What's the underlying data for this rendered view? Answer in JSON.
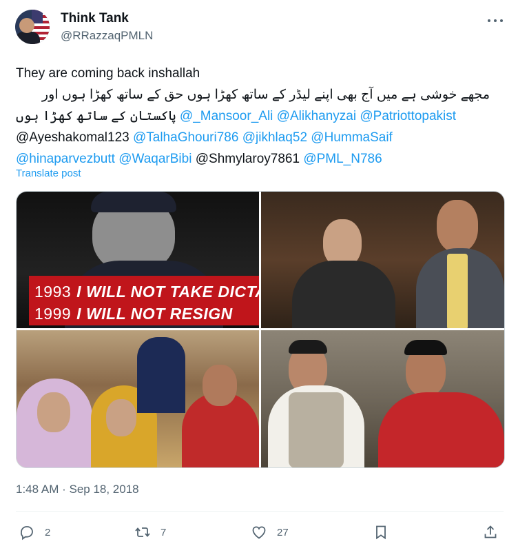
{
  "author": {
    "display_name": "Think Tank",
    "handle": "@RRazzaqPMLN"
  },
  "post": {
    "line1": "They are coming back inshallah",
    "urdu_line1": "مجھے خوشی ہے میں آج بھی اپنے لیڈر کے ساتھ کھڑا ہوں حق کے ساتھ کھڑا ہوں اور",
    "urdu_line2": "پاکستان کے ساتھ کھڑا ہوں",
    "mentions": [
      "@_Mansoor_Ali",
      "@Alikhanyzai",
      "@Patriottopakist",
      "@Ayeshakomal123",
      "@TalhaGhouri786",
      "@jikhlaq52",
      "@HummaSaif",
      "@hinaparvezbutt",
      "@WaqarBibi",
      "@Shmylaroy7861",
      "@PML_N786"
    ],
    "translate_label": "Translate post",
    "timestamp": "1:48 AM · Sep 18, 2018"
  },
  "media": {
    "banner_year1": "1993",
    "banner_text1": "I WILL NOT TAKE DICTATION",
    "banner_year2": "1999",
    "banner_text2": "I WILL NOT RESIGN"
  },
  "actions": {
    "replies": "2",
    "reposts": "7",
    "likes": "27"
  },
  "colors": {
    "link": "#1d9bf0",
    "muted": "#536471",
    "banner_red": "#c0151b"
  }
}
